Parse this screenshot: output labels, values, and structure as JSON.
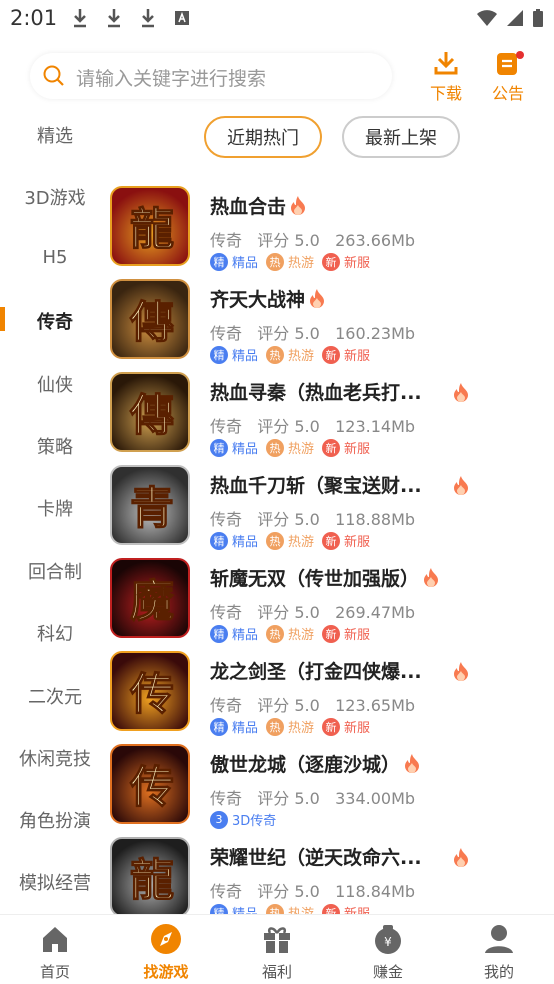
{
  "status_bar": {
    "time": "2:01"
  },
  "search": {
    "placeholder": "请输入关键字进行搜索"
  },
  "header_buttons": {
    "download": "下载",
    "notice": "公告"
  },
  "categories": [
    "精选",
    "3D游戏",
    "H5",
    "传奇",
    "仙侠",
    "策略",
    "卡牌",
    "回合制",
    "科幻",
    "二次元",
    "休闲竞技",
    "角色扮演",
    "模拟经营"
  ],
  "active_category": "传奇",
  "filters": {
    "recent_hot": "近期热门",
    "newest": "最新上架"
  },
  "games": [
    {
      "title": "热血合击",
      "genre": "传奇",
      "rating": "评分 5.0",
      "size": "263.66Mb",
      "tags": [
        [
          "精",
          "精品",
          "#4a7ef0"
        ],
        [
          "热",
          "热游",
          "#f0a060"
        ],
        [
          "新",
          "新服",
          "#f06050"
        ]
      ],
      "glyph": "龍"
    },
    {
      "title": "齐天大战神",
      "genre": "传奇",
      "rating": "评分 5.0",
      "size": "160.23Mb",
      "tags": [
        [
          "精",
          "精品",
          "#4a7ef0"
        ],
        [
          "热",
          "热游",
          "#f0a060"
        ],
        [
          "新",
          "新服",
          "#f06050"
        ]
      ],
      "glyph": "傳"
    },
    {
      "title": "热血寻秦（热血老兵打...",
      "genre": "传奇",
      "rating": "评分 5.0",
      "size": "123.14Mb",
      "tags": [
        [
          "精",
          "精品",
          "#4a7ef0"
        ],
        [
          "热",
          "热游",
          "#f0a060"
        ],
        [
          "新",
          "新服",
          "#f06050"
        ]
      ],
      "glyph": "傳"
    },
    {
      "title": "热血千刀斩（聚宝送财...",
      "genre": "传奇",
      "rating": "评分 5.0",
      "size": "118.88Mb",
      "tags": [
        [
          "精",
          "精品",
          "#4a7ef0"
        ],
        [
          "热",
          "热游",
          "#f0a060"
        ],
        [
          "新",
          "新服",
          "#f06050"
        ]
      ],
      "glyph": "青"
    },
    {
      "title": "斩魔无双（传世加强版）",
      "genre": "传奇",
      "rating": "评分 5.0",
      "size": "269.47Mb",
      "tags": [
        [
          "精",
          "精品",
          "#4a7ef0"
        ],
        [
          "热",
          "热游",
          "#f0a060"
        ],
        [
          "新",
          "新服",
          "#f06050"
        ]
      ],
      "glyph": "魔"
    },
    {
      "title": "龙之剑圣（打金四侠爆...",
      "genre": "传奇",
      "rating": "评分 5.0",
      "size": "123.65Mb",
      "tags": [
        [
          "精",
          "精品",
          "#4a7ef0"
        ],
        [
          "热",
          "热游",
          "#f0a060"
        ],
        [
          "新",
          "新服",
          "#f06050"
        ]
      ],
      "glyph": "传"
    },
    {
      "title": "傲世龙城（逐鹿沙城）",
      "genre": "传奇",
      "rating": "评分 5.0",
      "size": "334.00Mb",
      "tags": [
        [
          "3",
          "3D传奇",
          "#4a7ef0"
        ]
      ],
      "glyph": "传"
    },
    {
      "title": "荣耀世纪（逆天改命六...",
      "genre": "传奇",
      "rating": "评分 5.0",
      "size": "118.84Mb",
      "tags": [
        [
          "精",
          "精品",
          "#4a7ef0"
        ],
        [
          "热",
          "热游",
          "#f0a060"
        ],
        [
          "新",
          "新服",
          "#f06050"
        ]
      ],
      "glyph": "龍"
    }
  ],
  "nav": [
    {
      "label": "首页",
      "icon": "home-icon"
    },
    {
      "label": "找游戏",
      "icon": "compass-icon"
    },
    {
      "label": "福利",
      "icon": "gift-icon"
    },
    {
      "label": "赚金",
      "icon": "coin-bag-icon"
    },
    {
      "label": "我的",
      "icon": "user-icon"
    }
  ],
  "colors": {
    "accent": "#f08400"
  }
}
